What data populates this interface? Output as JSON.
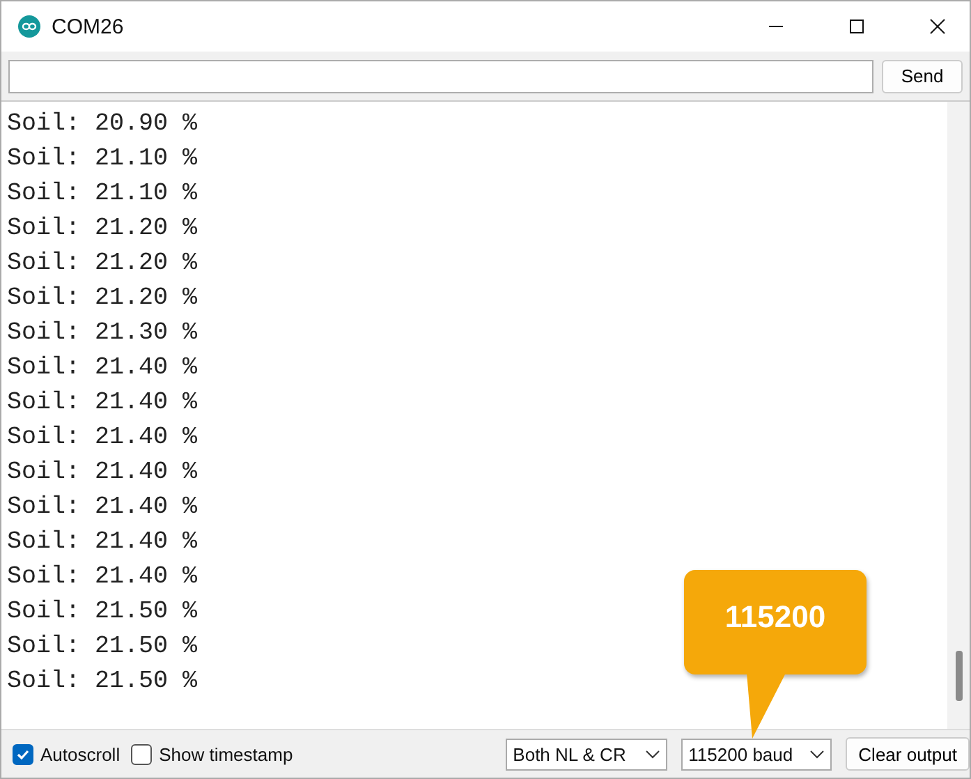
{
  "window": {
    "title": "COM26"
  },
  "send": {
    "button": "Send"
  },
  "output": {
    "lines": [
      "Soil: 20.90 %",
      "Soil: 21.10 %",
      "Soil: 21.10 %",
      "Soil: 21.20 %",
      "Soil: 21.20 %",
      "Soil: 21.20 %",
      "Soil: 21.30 %",
      "Soil: 21.40 %",
      "Soil: 21.40 %",
      "Soil: 21.40 %",
      "Soil: 21.40 %",
      "Soil: 21.40 %",
      "Soil: 21.40 %",
      "Soil: 21.40 %",
      "Soil: 21.50 %",
      "Soil: 21.50 %",
      "Soil: 21.50 %"
    ]
  },
  "status_bar": {
    "autoscroll": {
      "label": "Autoscroll",
      "checked": true
    },
    "timestamp": {
      "label": "Show timestamp",
      "checked": false
    },
    "line_ending": "Both NL & CR",
    "baud": "115200 baud",
    "clear": "Clear output"
  },
  "callout": {
    "text": "115200"
  }
}
